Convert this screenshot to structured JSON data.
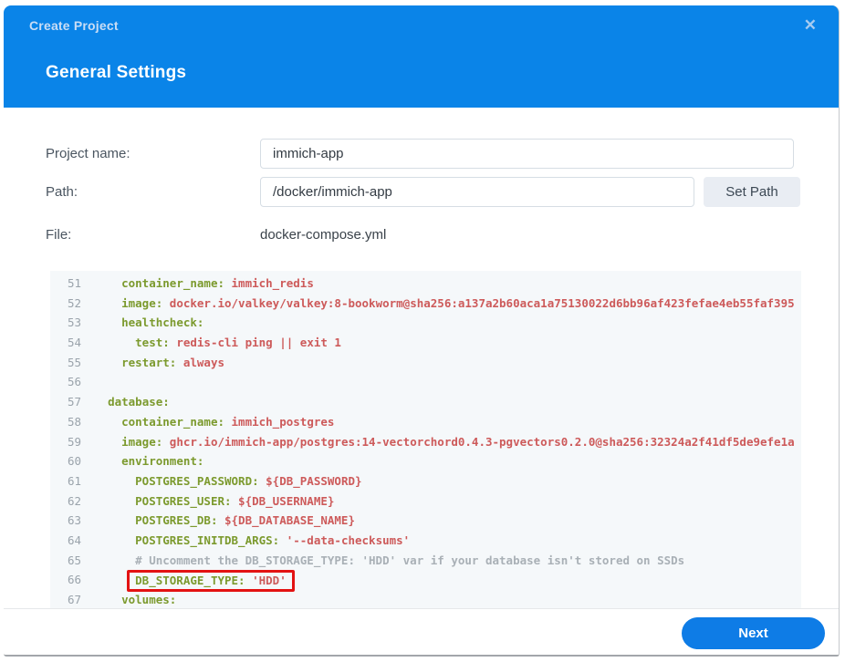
{
  "dialog": {
    "title": "Create Project",
    "close_icon": "✕",
    "section_title": "General Settings"
  },
  "form": {
    "project_name": {
      "label": "Project name:",
      "value": "immich-app"
    },
    "path": {
      "label": "Path:",
      "value": "/docker/immich-app",
      "button": "Set Path"
    },
    "file": {
      "label": "File:",
      "value": "docker-compose.yml"
    }
  },
  "editor": {
    "lines": [
      {
        "num": "51",
        "indent": 4,
        "key": "container_name:",
        "value": "immich_redis"
      },
      {
        "num": "52",
        "indent": 4,
        "key": "image:",
        "value": "docker.io/valkey/valkey:8-bookworm@sha256:a137a2b60aca1a75130022d6bb96af423fefae4eb55faf395"
      },
      {
        "num": "53",
        "indent": 4,
        "key": "healthcheck:"
      },
      {
        "num": "54",
        "indent": 6,
        "key": "test:",
        "value": "redis-cli ping || exit 1"
      },
      {
        "num": "55",
        "indent": 4,
        "key": "restart:",
        "value": "always"
      },
      {
        "num": "56",
        "indent": 0
      },
      {
        "num": "57",
        "indent": 2,
        "key": "database:"
      },
      {
        "num": "58",
        "indent": 4,
        "key": "container_name:",
        "value": "immich_postgres"
      },
      {
        "num": "59",
        "indent": 4,
        "key": "image:",
        "value": "ghcr.io/immich-app/postgres:14-vectorchord0.4.3-pgvectors0.2.0@sha256:32324a2f41df5de9efe1a"
      },
      {
        "num": "60",
        "indent": 4,
        "key": "environment:"
      },
      {
        "num": "61",
        "indent": 6,
        "key": "POSTGRES_PASSWORD:",
        "value": "${DB_PASSWORD}"
      },
      {
        "num": "62",
        "indent": 6,
        "key": "POSTGRES_USER:",
        "value": "${DB_USERNAME}"
      },
      {
        "num": "63",
        "indent": 6,
        "key": "POSTGRES_DB:",
        "value": "${DB_DATABASE_NAME}"
      },
      {
        "num": "64",
        "indent": 6,
        "key": "POSTGRES_INITDB_ARGS:",
        "value": "'--data-checksums'"
      },
      {
        "num": "65",
        "indent": 6,
        "comment": "# Uncomment the DB_STORAGE_TYPE: 'HDD' var if your database isn't stored on SSDs"
      },
      {
        "num": "66",
        "indent": 6,
        "key": "DB_STORAGE_TYPE:",
        "value": "'HDD'",
        "highlight": true
      },
      {
        "num": "67",
        "indent": 4,
        "key": "volumes:"
      }
    ]
  },
  "footer": {
    "next_label": "Next"
  },
  "colors": {
    "header_blue": "#0a84e8",
    "next_button_blue": "#0e7ce6",
    "key_green": "#7c9a2e",
    "value_red": "#cd5a5a",
    "comment_gray": "#a9b0b6",
    "line_number_gray": "#9aa3ab",
    "editor_background": "#f5f8fa",
    "highlight_red": "#e31212"
  }
}
